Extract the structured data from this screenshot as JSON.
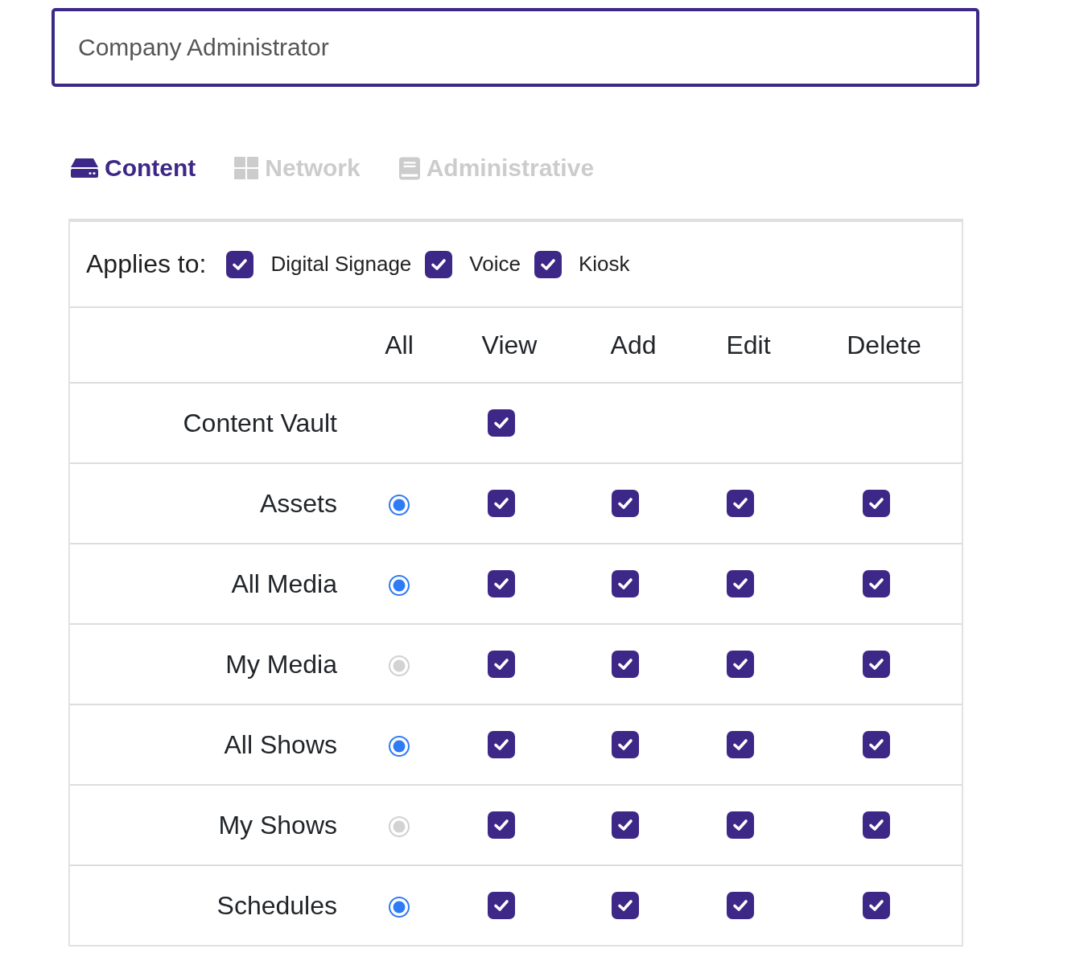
{
  "role_field": {
    "value": "Company Administrator"
  },
  "tabs": [
    {
      "label": "Content",
      "selected": true
    },
    {
      "label": "Network",
      "selected": false
    },
    {
      "label": "Administrative",
      "selected": false
    }
  ],
  "applies_to": {
    "label": "Applies to:",
    "options": [
      {
        "label": "Digital Signage",
        "checked": true
      },
      {
        "label": "Voice",
        "checked": true
      },
      {
        "label": "Kiosk",
        "checked": true
      }
    ]
  },
  "permissions": {
    "columns": [
      "All",
      "View",
      "Add",
      "Edit",
      "Delete"
    ],
    "rows": [
      {
        "label": "Content Vault",
        "checks": [
          {
            "checked": true
          }
        ]
      },
      {
        "label": "Assets",
        "all": {
          "selected": true,
          "disabled": false
        },
        "checks": [
          {
            "checked": true
          },
          {
            "checked": true
          },
          {
            "checked": true
          },
          {
            "checked": true
          }
        ]
      },
      {
        "label": "All Media",
        "all": {
          "selected": true,
          "disabled": false
        },
        "checks": [
          {
            "checked": true
          },
          {
            "checked": true
          },
          {
            "checked": true
          },
          {
            "checked": true
          }
        ]
      },
      {
        "label": "My Media",
        "all": {
          "selected": true,
          "disabled": true
        },
        "checks": [
          {
            "checked": true
          },
          {
            "checked": true
          },
          {
            "checked": true
          },
          {
            "checked": true
          }
        ]
      },
      {
        "label": "All Shows",
        "all": {
          "selected": true,
          "disabled": false
        },
        "checks": [
          {
            "checked": true
          },
          {
            "checked": true
          },
          {
            "checked": true
          },
          {
            "checked": true
          }
        ]
      },
      {
        "label": "My Shows",
        "all": {
          "selected": true,
          "disabled": true
        },
        "checks": [
          {
            "checked": true
          },
          {
            "checked": true
          },
          {
            "checked": true
          },
          {
            "checked": true
          }
        ]
      },
      {
        "label": "Schedules",
        "all": {
          "selected": true,
          "disabled": false
        },
        "checks": [
          {
            "checked": true
          },
          {
            "checked": true
          },
          {
            "checked": true
          },
          {
            "checked": true
          }
        ]
      }
    ]
  }
}
